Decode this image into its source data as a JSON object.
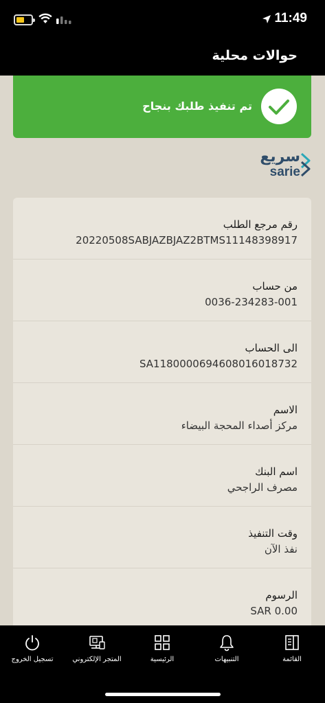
{
  "status_bar": {
    "time": "11:49",
    "icons": [
      "battery-icon",
      "wifi-icon",
      "signal-icon",
      "location-arrow-icon"
    ]
  },
  "header": {
    "title": "حوالات محلية"
  },
  "banner": {
    "message": "تم تنفيذ طلبك بنجاح",
    "icon": "check-icon",
    "color": "#4caf3d"
  },
  "logo": {
    "arabic": "سريع",
    "latin": "sarie"
  },
  "details": [
    {
      "label": "رقم مرجع الطلب",
      "value": "20220508SABJAZBJAZ2BTMS11148398917"
    },
    {
      "label": "من حساب",
      "value": "0036-234283-001"
    },
    {
      "label": "الى الحساب",
      "value": "SA1180000694608016018732"
    },
    {
      "label": "الاسم",
      "value": "مركز أصداء المحجة البيضاء"
    },
    {
      "label": "اسم البنك",
      "value": "مصرف الراجحي"
    },
    {
      "label": "وقت التنفيذ",
      "value": "نفذ الآن"
    },
    {
      "label": "الرسوم",
      "value": "SAR 0.00"
    }
  ],
  "bottom_nav": [
    {
      "label": "تسجيل الخروج",
      "icon": "power-icon"
    },
    {
      "label": "المتجر الإلكتروني",
      "icon": "store-icon"
    },
    {
      "label": "الرئيسية",
      "icon": "grid-icon"
    },
    {
      "label": "التنبيهات",
      "icon": "bell-icon"
    },
    {
      "label": "القائمة",
      "icon": "menu-icon"
    }
  ],
  "colors": {
    "background": "#dcd7cc",
    "card": "#e9e5dc",
    "success": "#4caf3d",
    "bars": "#000000",
    "brand": "#2f4d6a"
  }
}
